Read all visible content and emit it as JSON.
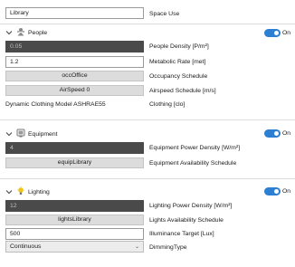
{
  "space_type": {
    "value": "Library",
    "label": "Space Use"
  },
  "people": {
    "title": "People",
    "toggle_label": "On",
    "density": {
      "value": "0.05",
      "label": "People Density [P/m²]"
    },
    "metabolic": {
      "value": "1.2",
      "label": "Metabolic Rate [met]"
    },
    "occupancy": {
      "value": "occOffice",
      "label": "Occupancy Schedule"
    },
    "airspeed": {
      "value": "AirSpeed 0",
      "label": "Airspeed Schedule [m/s]"
    },
    "clothing": {
      "value": "Dynamic Clothing Model ASHRAE55",
      "label": "Clothing [clo]"
    }
  },
  "equipment": {
    "title": "Equipment",
    "toggle_label": "On",
    "power_density": {
      "value": "4",
      "label": "Equipment Power Density [W/m²]"
    },
    "availability": {
      "value": "equipLibrary",
      "label": "Equipment Availability  Schedule"
    }
  },
  "lighting": {
    "title": "Lighting",
    "toggle_label": "On",
    "power_density": {
      "value": "12",
      "label": "Lighting Power Density [W/m²]"
    },
    "availability": {
      "value": "lightsLibrary",
      "label": "Lights Availability Schedule"
    },
    "illuminance": {
      "value": "500",
      "label": "Illuminance Target [Lux]"
    },
    "dimming": {
      "value": "Continuous",
      "label": "DimmingType"
    }
  },
  "colors": {
    "accent": "#2d7fd3",
    "dark_field": "#4a4a4a",
    "button": "#dcdcdc"
  }
}
